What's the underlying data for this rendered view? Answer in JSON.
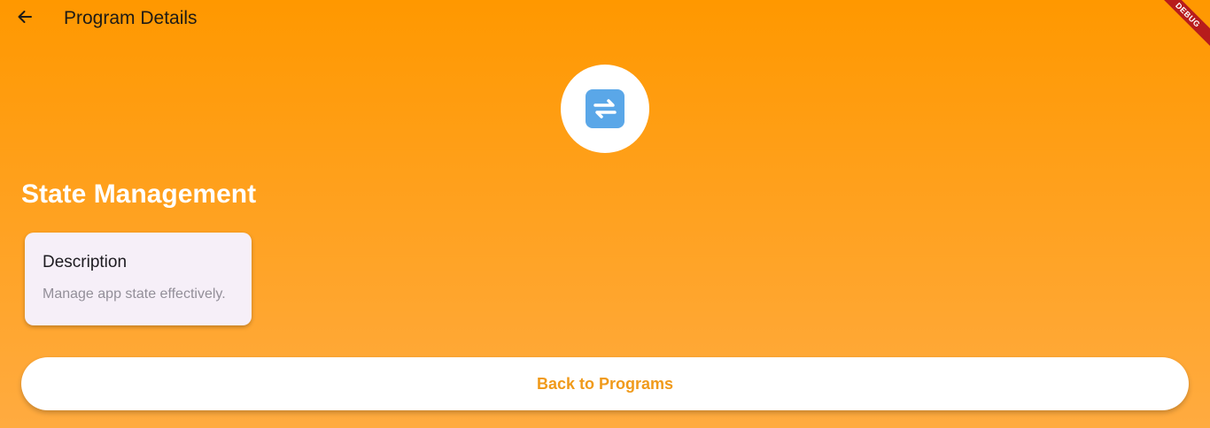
{
  "appbar": {
    "title": "Program Details",
    "back_icon": "arrow-left-icon"
  },
  "debug_banner": "DEBUG",
  "program": {
    "icon": "arrows-counterclockwise-emoji",
    "title": "State Management"
  },
  "description_card": {
    "heading": "Description",
    "text": "Manage app state effectively."
  },
  "actions": {
    "back_to_programs": "Back to Programs"
  },
  "colors": {
    "background_top": "#ff9800",
    "background_bottom": "#ffab40",
    "accent_text": "#f09a1a",
    "card_background": "#f6eff8"
  }
}
